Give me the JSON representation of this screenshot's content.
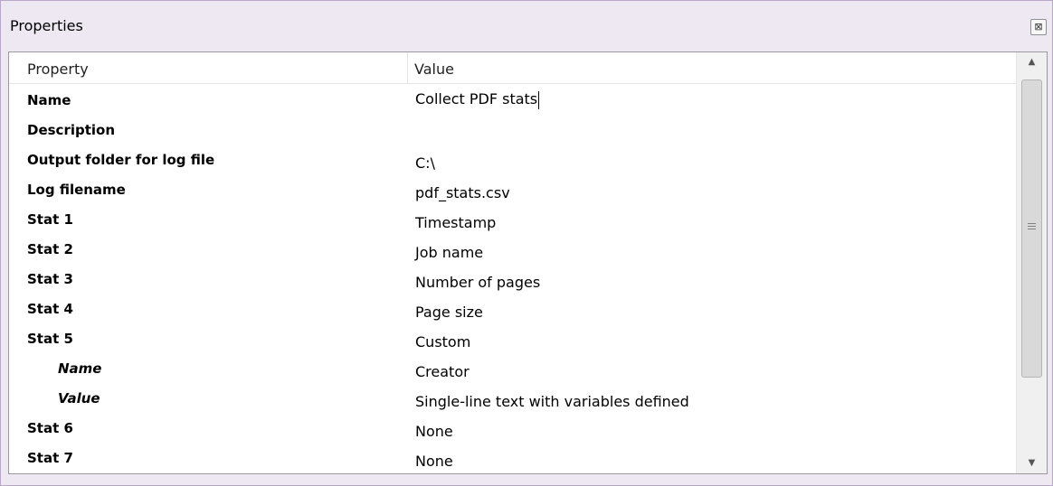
{
  "window": {
    "title": "Properties",
    "close_icon": "close-icon"
  },
  "table": {
    "columns": [
      "Property",
      "Value"
    ],
    "rows": [
      {
        "property": "Name",
        "value": "Collect PDF stats"
      },
      {
        "property": "Description",
        "value": ""
      },
      {
        "property": "Output folder for log file",
        "value": "C:\\"
      },
      {
        "property": "Log filename",
        "value": "pdf_stats.csv"
      },
      {
        "property": "Stat 1",
        "value": "Timestamp"
      },
      {
        "property": "Stat 2",
        "value": "Job name"
      },
      {
        "property": "Stat 3",
        "value": "Number of pages"
      },
      {
        "property": "Stat 4",
        "value": "Page size"
      },
      {
        "property": "Stat 5",
        "value": "Custom"
      },
      {
        "property": "Name",
        "value": "Creator"
      },
      {
        "property": "Value",
        "value": "Single-line text with variables defined"
      },
      {
        "property": "Stat 6",
        "value": "None"
      },
      {
        "property": "Stat 7",
        "value": "None"
      }
    ]
  },
  "scrollbar": {
    "up_icon": "scroll-up-arrow-icon",
    "down_icon": "scroll-down-arrow-icon",
    "grip_icon": "scroll-grip-icon"
  }
}
